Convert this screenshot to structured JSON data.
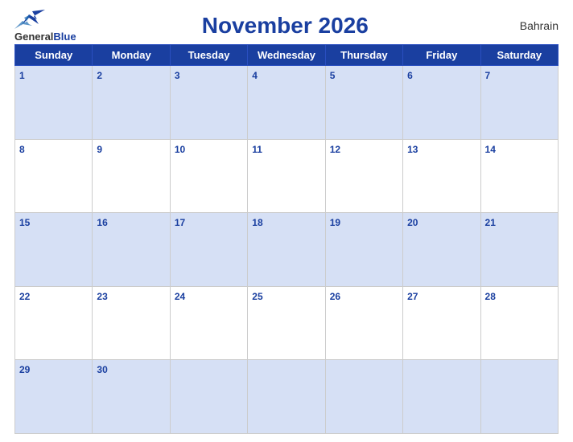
{
  "header": {
    "title": "November 2026",
    "country": "Bahrain",
    "logo_general": "General",
    "logo_blue": "Blue"
  },
  "weekdays": [
    "Sunday",
    "Monday",
    "Tuesday",
    "Wednesday",
    "Thursday",
    "Friday",
    "Saturday"
  ],
  "weeks": [
    [
      {
        "day": "1",
        "empty": false
      },
      {
        "day": "2",
        "empty": false
      },
      {
        "day": "3",
        "empty": false
      },
      {
        "day": "4",
        "empty": false
      },
      {
        "day": "5",
        "empty": false
      },
      {
        "day": "6",
        "empty": false
      },
      {
        "day": "7",
        "empty": false
      }
    ],
    [
      {
        "day": "8",
        "empty": false
      },
      {
        "day": "9",
        "empty": false
      },
      {
        "day": "10",
        "empty": false
      },
      {
        "day": "11",
        "empty": false
      },
      {
        "day": "12",
        "empty": false
      },
      {
        "day": "13",
        "empty": false
      },
      {
        "day": "14",
        "empty": false
      }
    ],
    [
      {
        "day": "15",
        "empty": false
      },
      {
        "day": "16",
        "empty": false
      },
      {
        "day": "17",
        "empty": false
      },
      {
        "day": "18",
        "empty": false
      },
      {
        "day": "19",
        "empty": false
      },
      {
        "day": "20",
        "empty": false
      },
      {
        "day": "21",
        "empty": false
      }
    ],
    [
      {
        "day": "22",
        "empty": false
      },
      {
        "day": "23",
        "empty": false
      },
      {
        "day": "24",
        "empty": false
      },
      {
        "day": "25",
        "empty": false
      },
      {
        "day": "26",
        "empty": false
      },
      {
        "day": "27",
        "empty": false
      },
      {
        "day": "28",
        "empty": false
      }
    ],
    [
      {
        "day": "29",
        "empty": false
      },
      {
        "day": "30",
        "empty": false
      },
      {
        "day": "",
        "empty": true
      },
      {
        "day": "",
        "empty": true
      },
      {
        "day": "",
        "empty": true
      },
      {
        "day": "",
        "empty": true
      },
      {
        "day": "",
        "empty": true
      }
    ]
  ]
}
